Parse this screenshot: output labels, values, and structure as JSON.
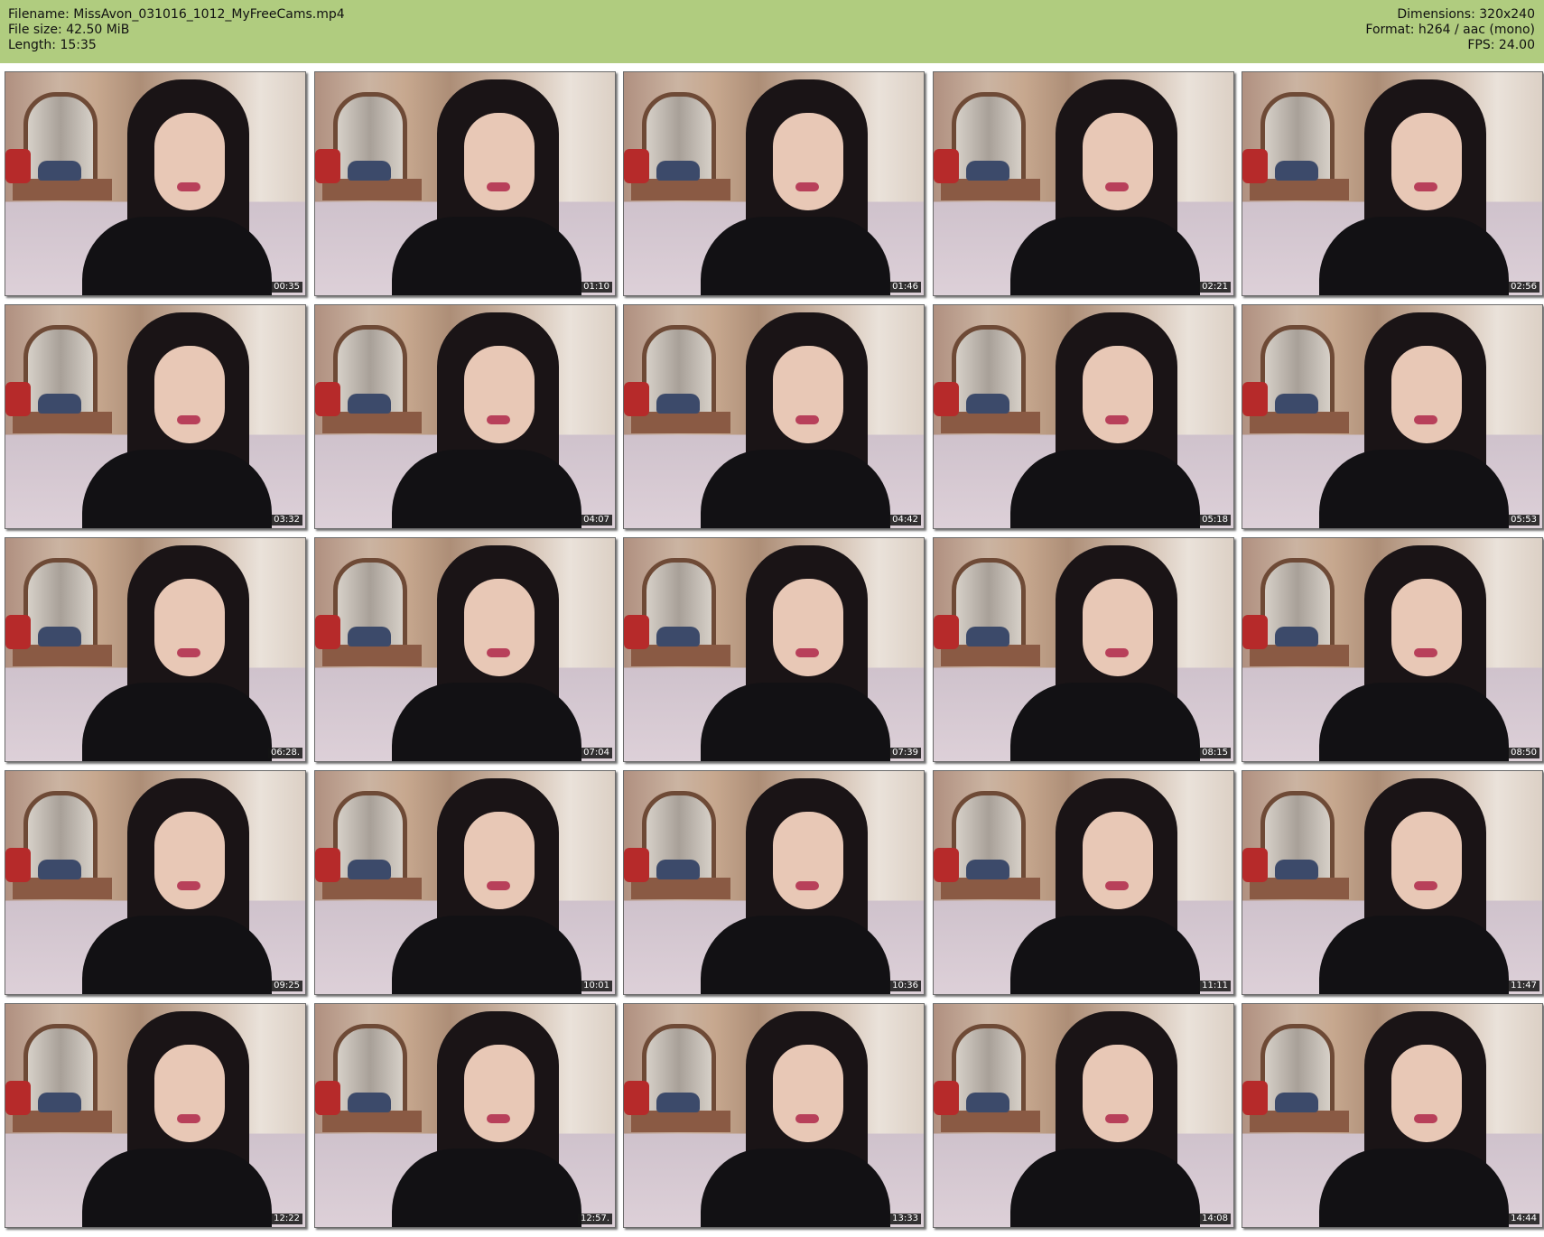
{
  "header": {
    "filename_line": "Filename: MissAvon_031016_1012_MyFreeCams.mp4",
    "filesize_line": "File size: 42.50 MiB",
    "length_line": "Length: 15:35",
    "dimensions_line": "Dimensions: 320x240",
    "format_line": "Format: h264 / aac (mono)",
    "fps_line": "FPS: 24.00",
    "background_color": "#b0cc7f"
  },
  "thumbnails": [
    {
      "timestamp": "00:35"
    },
    {
      "timestamp": "01:10"
    },
    {
      "timestamp": "01:46"
    },
    {
      "timestamp": "02:21"
    },
    {
      "timestamp": "02:56"
    },
    {
      "timestamp": "03:32"
    },
    {
      "timestamp": "04:07"
    },
    {
      "timestamp": "04:42"
    },
    {
      "timestamp": "05:18"
    },
    {
      "timestamp": "05:53"
    },
    {
      "timestamp": "06:28."
    },
    {
      "timestamp": "07:04"
    },
    {
      "timestamp": "07:39"
    },
    {
      "timestamp": "08:15"
    },
    {
      "timestamp": "08:50"
    },
    {
      "timestamp": "09:25"
    },
    {
      "timestamp": "10:01"
    },
    {
      "timestamp": "10:36"
    },
    {
      "timestamp": "11:11"
    },
    {
      "timestamp": "11:47"
    },
    {
      "timestamp": "12:22"
    },
    {
      "timestamp": "12:57."
    },
    {
      "timestamp": "13:33"
    },
    {
      "timestamp": "14:08"
    },
    {
      "timestamp": "14:44"
    }
  ]
}
